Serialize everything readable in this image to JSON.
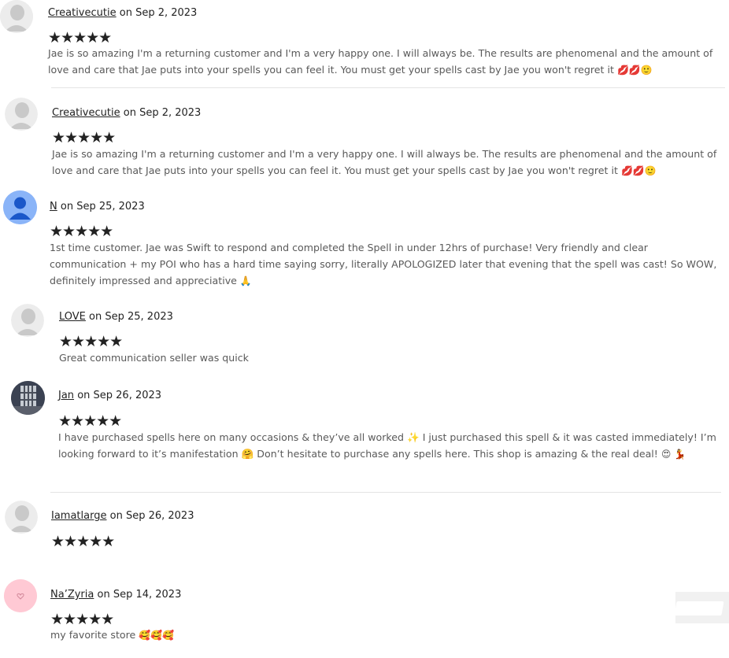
{
  "reviews": [
    {
      "reviewer": "Creativecutie",
      "date_text": "on Sep 2, 2023",
      "rating": "★★★★★",
      "text": "Jae is so amazing I'm a returning customer and I'm a very happy one. I will always be. The results are phenomenal and the amount of love and care that Jae puts into your spells you can feel it. You must get your spells cast by Jae you won't regret it",
      "emoji": "💋💋🙂",
      "avatar": "default-gray-avatar"
    },
    {
      "reviewer": "Creativecutie",
      "date_text": "on Sep 2, 2023",
      "rating": "★★★★★",
      "text": "Jae is so amazing I'm a returning customer and I'm a very happy one. I will always be. The results are phenomenal and the amount of love and care that Jae puts into your spells you can feel it. You must get your spells cast by Jae you won't regret it",
      "emoji": "💋💋🙂",
      "avatar": "default-gray-avatar"
    },
    {
      "reviewer": "N",
      "date_text": "on Sep 25, 2023",
      "rating": "★★★★★",
      "text": "1st time customer. Jae was Swift to respond and completed the Spell in under 12hrs of purchase! Very friendly and clear communication + my POI who has a hard time saying sorry, literally APOLOGIZED later that evening that the spell was cast! So WOW, definitely impressed and appreciative",
      "emoji": "🙏",
      "avatar": "blue-person-avatar"
    },
    {
      "reviewer": "LOVE",
      "date_text": "on Sep 25, 2023",
      "rating": "★★★★★",
      "text": "Great communication seller was quick",
      "emoji": "",
      "avatar": "default-gray-avatar"
    },
    {
      "reviewer": "Jan",
      "date_text": "on Sep 26, 2023",
      "rating": "★★★★★",
      "text": "I have purchased spells here on many occasions & they’ve all worked ✨ I just purchased this spell & it was casted immediately! I’m looking forward to it’s manifestation 🤗 Don’t hesitate to purchase any spells here. This shop is amazing & the real deal!",
      "emoji": "😍 💃",
      "avatar": "photo-avatar"
    },
    {
      "reviewer": "Iamatlarge",
      "date_text": "on Sep 26, 2023",
      "rating": "★★★★★",
      "text": "",
      "emoji": "",
      "avatar": "default-gray-avatar"
    },
    {
      "reviewer": "Na’Zyria",
      "date_text": "on Sep 14, 2023",
      "rating": "★★★★★",
      "text": "my favorite store",
      "emoji": "🥰🥰🥰",
      "avatar": "pink-heart-avatar"
    }
  ],
  "colors": {
    "text": "#222222",
    "review_text": "#595959",
    "divider": "#e4e4e4",
    "avatar_gray": "#d9d9d9",
    "avatar_blue": "#8ab4f8",
    "avatar_pink": "#ffc9d4"
  }
}
